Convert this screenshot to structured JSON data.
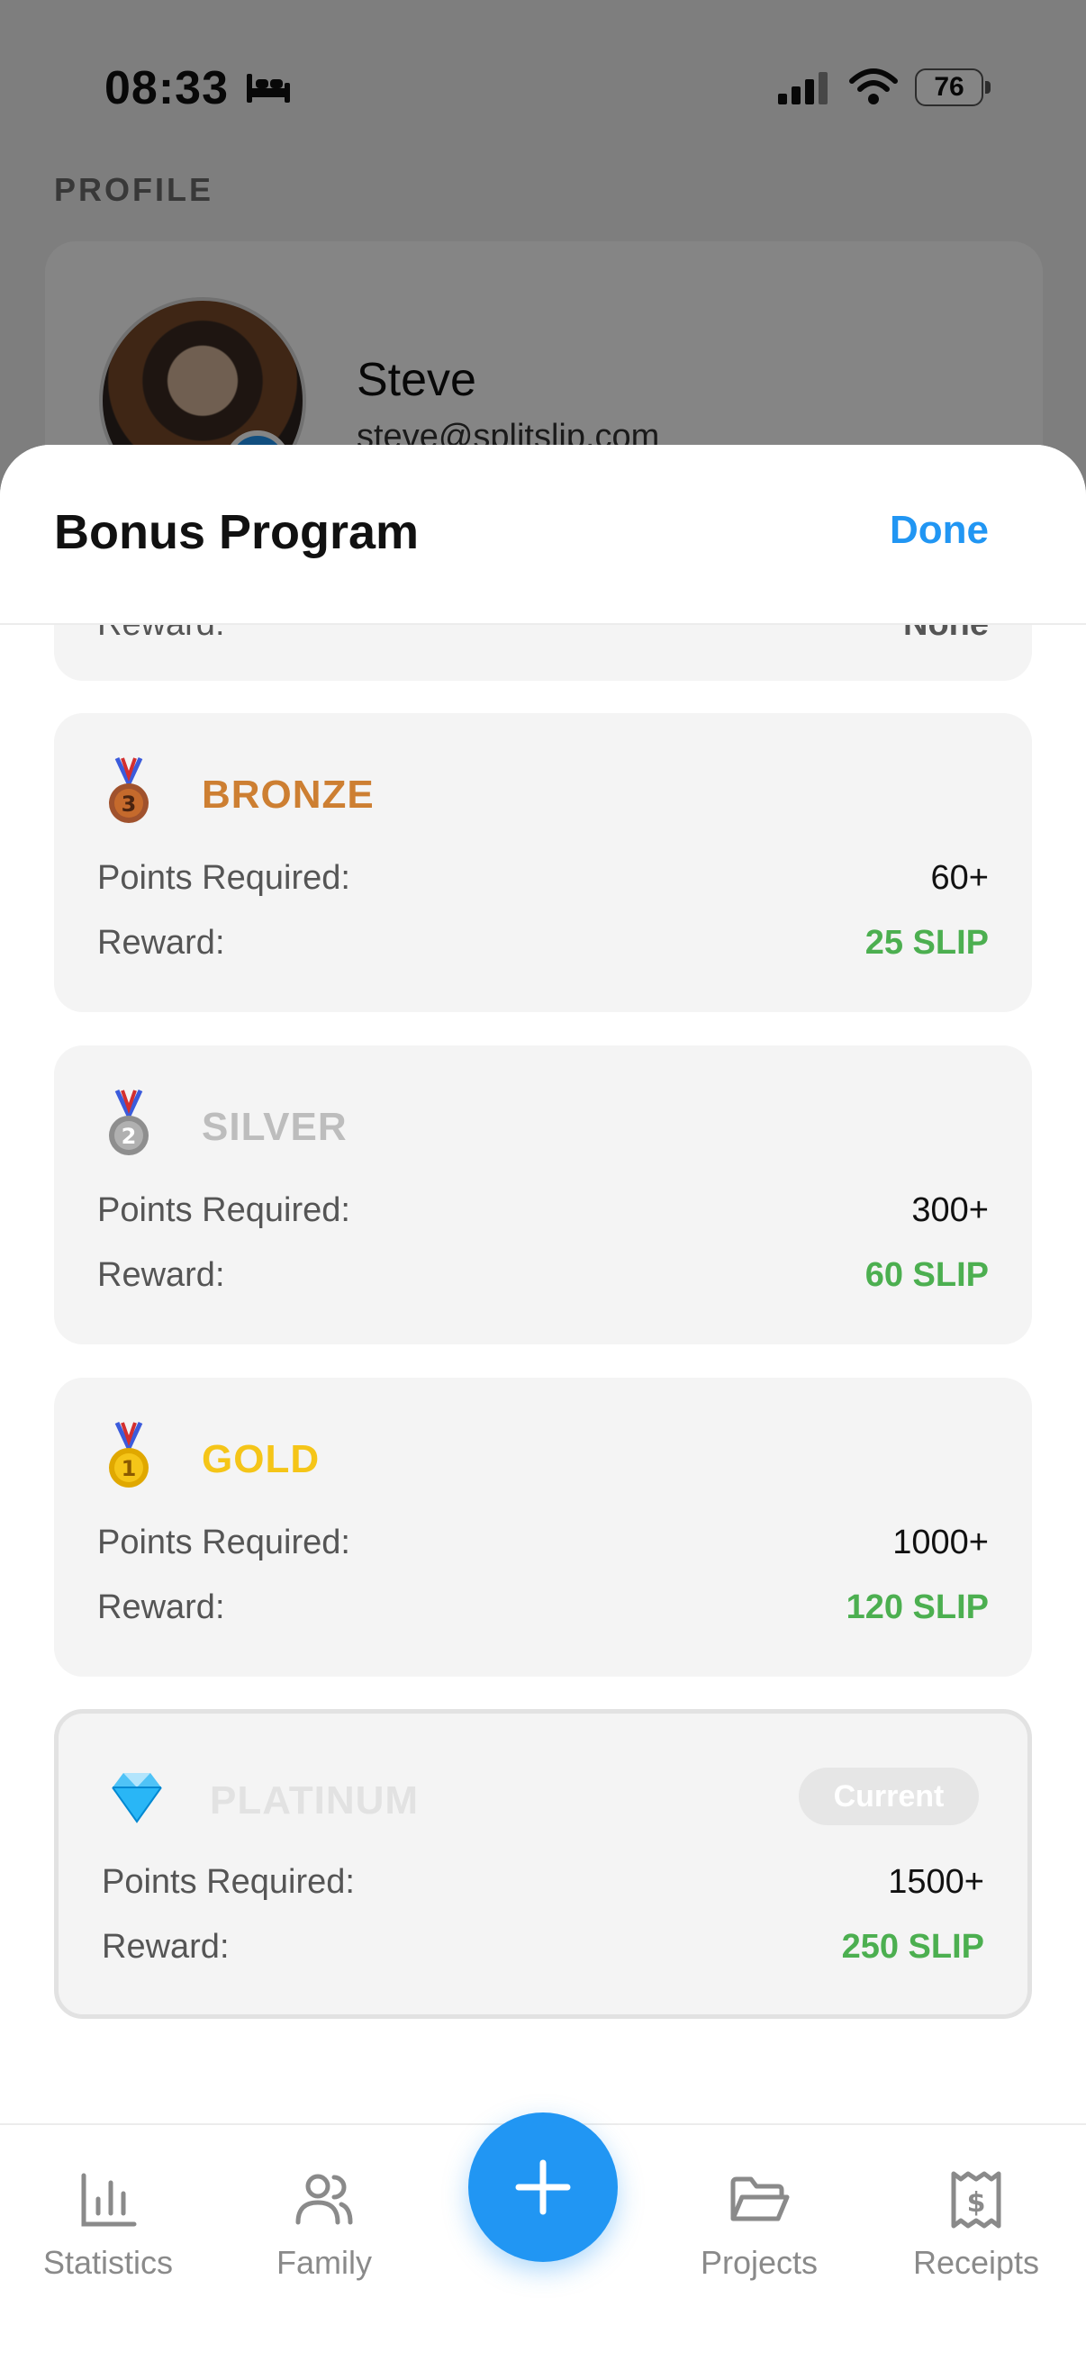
{
  "status_bar": {
    "time": "08:33",
    "battery": "76"
  },
  "profile": {
    "heading": "PROFILE",
    "name": "Steve",
    "email": "steve@splitslip.com"
  },
  "sheet": {
    "title": "Bonus Program",
    "done_label": "Done",
    "partial_row": {
      "label": "Reward:",
      "value": "None"
    }
  },
  "tiers": [
    {
      "name": "BRONZE",
      "icon": "bronze-medal-icon",
      "color": "#cd7f32",
      "points_label": "Points Required:",
      "points": "60+",
      "reward_label": "Reward:",
      "reward": "25 SLIP"
    },
    {
      "name": "SILVER",
      "icon": "silver-medal-icon",
      "color": "#bdbdbd",
      "points_label": "Points Required:",
      "points": "300+",
      "reward_label": "Reward:",
      "reward": "60 SLIP"
    },
    {
      "name": "GOLD",
      "icon": "gold-medal-icon",
      "color": "#f5c518",
      "points_label": "Points Required:",
      "points": "1000+",
      "reward_label": "Reward:",
      "reward": "120 SLIP"
    },
    {
      "name": "PLATINUM",
      "icon": "diamond-icon",
      "color": "#e2e2e2",
      "badge": "Current",
      "points_label": "Points Required:",
      "points": "1500+",
      "reward_label": "Reward:",
      "reward": "250 SLIP"
    }
  ],
  "tab_bar": {
    "items": [
      {
        "label": "Statistics",
        "icon": "bar-chart-icon"
      },
      {
        "label": "Family",
        "icon": "users-icon"
      },
      {
        "label": "Projects",
        "icon": "folder-icon"
      },
      {
        "label": "Receipts",
        "icon": "receipt-icon"
      }
    ],
    "fab_icon": "plus-icon"
  },
  "colors": {
    "accent": "#2196f3",
    "reward_green": "#4caf50"
  }
}
